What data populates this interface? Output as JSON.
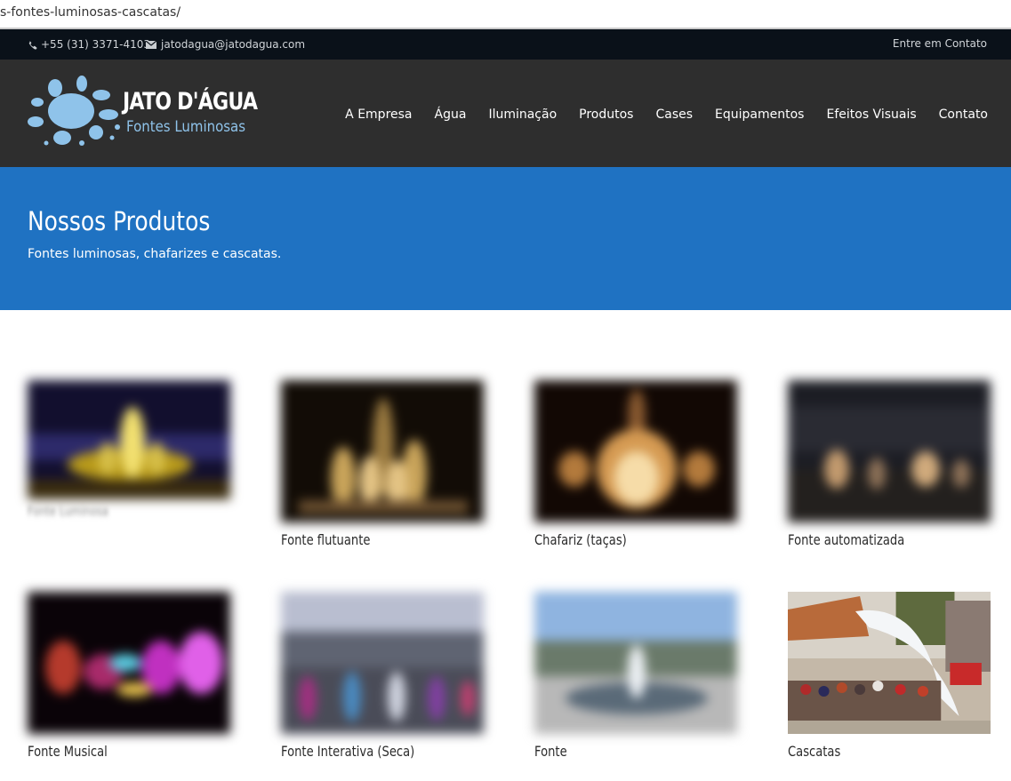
{
  "browser": {
    "url": "s-fontes-luminosas-cascatas/"
  },
  "topbar": {
    "phone": "+55 (31) 3371-4103",
    "email": "jatodagua@jatodagua.com",
    "contact_link": "Entre em Contato"
  },
  "logo": {
    "brand": "JATO D'ÁGUA",
    "subtitle": "Fontes Luminosas"
  },
  "nav": {
    "items": [
      "A Empresa",
      "Água",
      "Iluminação",
      "Produtos",
      "Cases",
      "Equipamentos",
      "Efeitos Visuais",
      "Contato"
    ]
  },
  "hero": {
    "title": "Nossos Produtos",
    "subtitle": "Fontes luminosas, chafarizes e cascatas."
  },
  "products": [
    {
      "label": "Fonte Luminosa"
    },
    {
      "label": "Fonte flutuante"
    },
    {
      "label": "Chafariz (taças)"
    },
    {
      "label": "Fonte automatizada"
    },
    {
      "label": "Fonte Musical"
    },
    {
      "label": "Fonte Interativa (Seca)"
    },
    {
      "label": "Fonte"
    },
    {
      "label": "Cascatas"
    }
  ],
  "colors": {
    "topbar_bg": "#0a1119",
    "header_bg": "#2e2e2e",
    "hero_bg": "#1f72c2",
    "logo_accent": "#8fc3ea"
  }
}
